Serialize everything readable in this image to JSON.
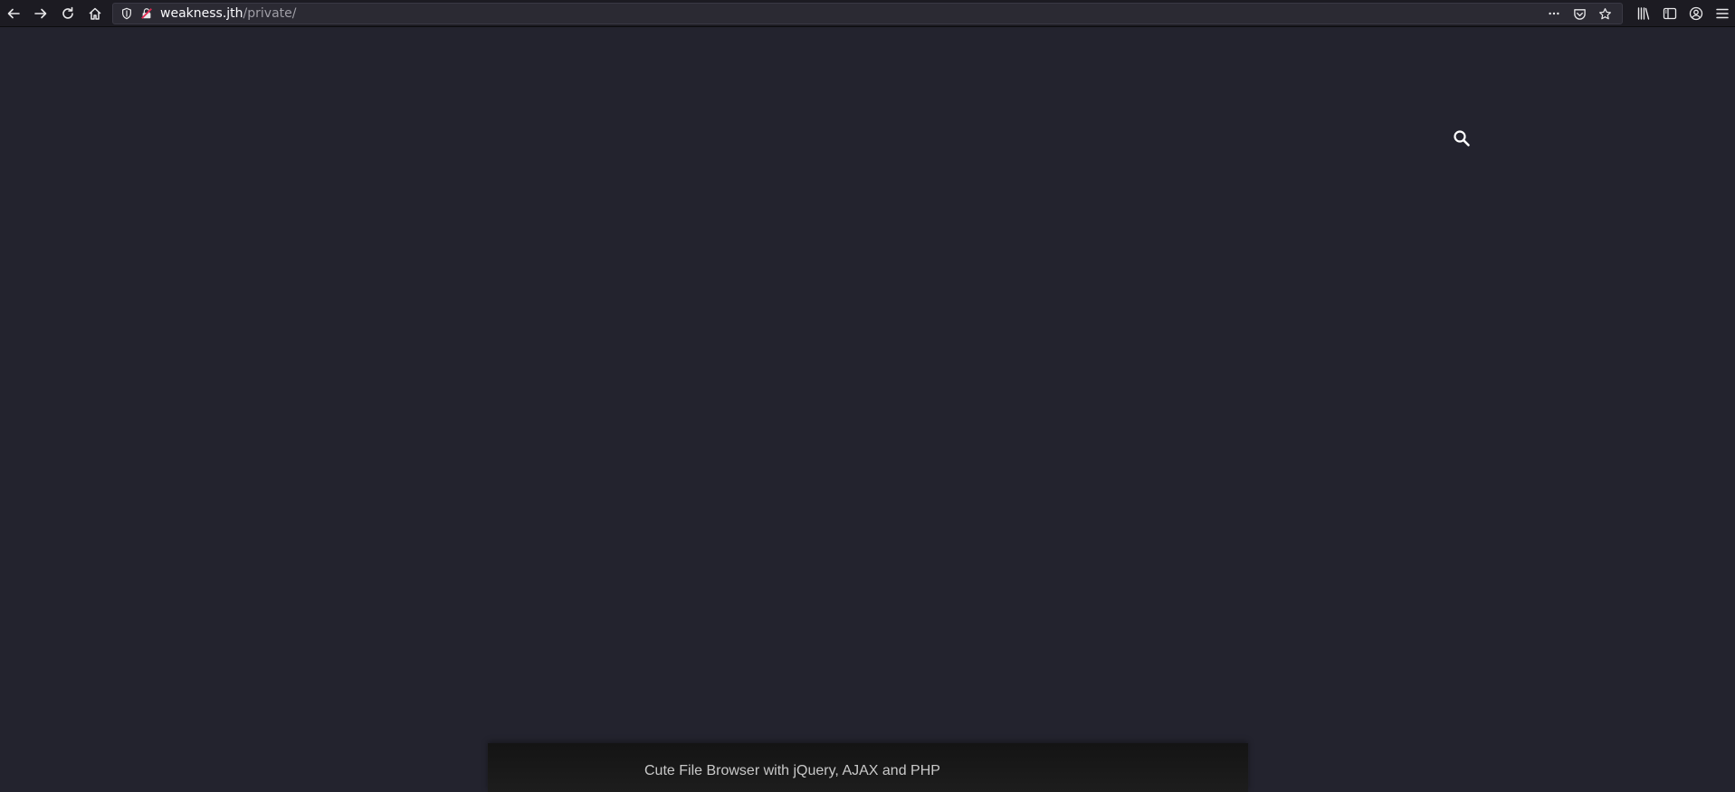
{
  "browser": {
    "url_host": "weakness.jth",
    "url_path": "/private/",
    "icons": {
      "back": "arrow-left-icon",
      "forward": "arrow-right-icon",
      "reload": "reload-icon",
      "home": "home-icon",
      "tracking": "shield-icon",
      "insecure": "insecure-lock-icon",
      "page_actions": "more-horizontal-icon",
      "pocket": "pocket-icon",
      "bookmark": "star-icon",
      "library": "library-icon",
      "sidebar": "sidebar-icon",
      "account": "account-icon",
      "menu": "hamburger-menu-icon"
    }
  },
  "page": {
    "background": "#23232e",
    "search_icon": "search-icon",
    "footer_text": "Cute File Browser with jQuery, AJAX and PHP"
  }
}
